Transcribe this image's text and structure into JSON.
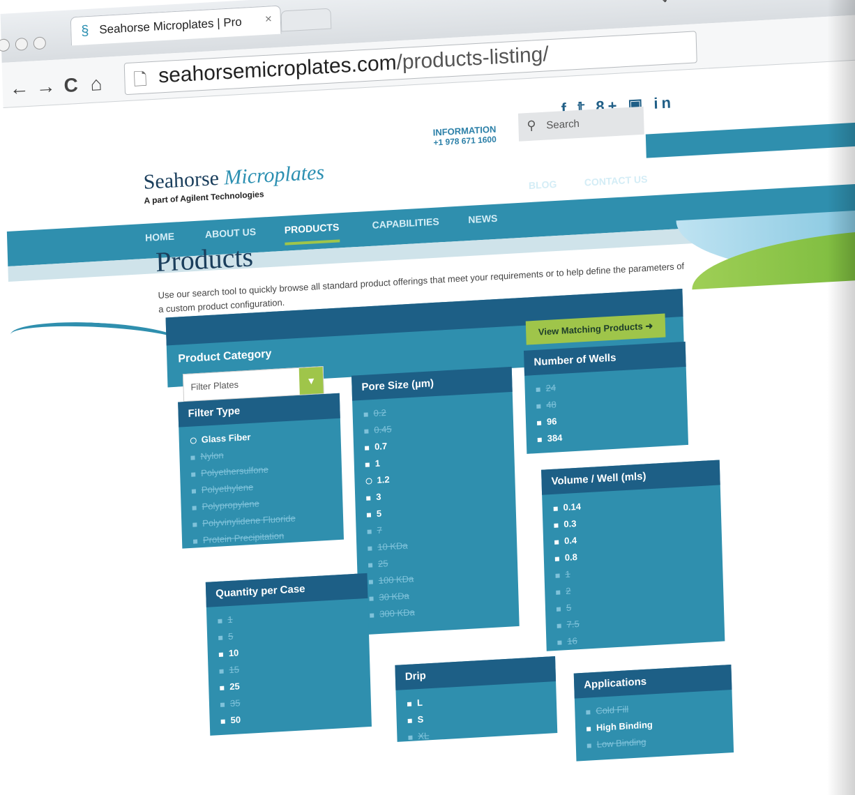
{
  "browser": {
    "tab_title": "Seahorse Microplates | Pro",
    "tab_close": "×",
    "url_host": "seahorsemicroplates.com",
    "url_path": "/products-listing/",
    "nav": {
      "back": "←",
      "forward": "→",
      "reload": "C",
      "home": "⌂"
    },
    "tools": "🔍 ☆"
  },
  "header": {
    "social": "f 𝕥 8+ ▣ in",
    "info_label": "INFORMATION",
    "info_phone": "+1 978 671 1600",
    "search_placeholder": "Search",
    "logo_name_a": "Seahorse",
    "logo_name_b": "Microplates",
    "logo_tag": "A part of Agilent Technologies"
  },
  "nav": {
    "items": [
      "HOME",
      "ABOUT US",
      "PRODUCTS",
      "CAPABILITIES",
      "NEWS",
      "BLOG",
      "CONTACT US"
    ]
  },
  "main": {
    "title": "Products",
    "description": "Use our search tool to quickly browse all standard product offerings that meet your requirements or to help define the parameters of a custom product configuration.",
    "category_title": "Product Category",
    "category_value": "Filter Plates",
    "view_button": "View Matching Products"
  },
  "filters": {
    "filter_type": {
      "title": "Filter Type",
      "items": [
        {
          "label": "Glass Fiber",
          "state": "selected"
        },
        {
          "label": "Nylon",
          "state": "off"
        },
        {
          "label": "Polyethersulfone",
          "state": "off"
        },
        {
          "label": "Polyethylene",
          "state": "off"
        },
        {
          "label": "Polypropylene",
          "state": "off"
        },
        {
          "label": "Polyvinylidene Fluoride",
          "state": "off"
        },
        {
          "label": "Protein Precipitation",
          "state": "off"
        }
      ]
    },
    "pore_size": {
      "title": "Pore Size (µm)",
      "items": [
        {
          "label": "0.2",
          "state": "off"
        },
        {
          "label": "0.45",
          "state": "off"
        },
        {
          "label": "0.7",
          "state": "on"
        },
        {
          "label": "1",
          "state": "on"
        },
        {
          "label": "1.2",
          "state": "selected"
        },
        {
          "label": "3",
          "state": "on"
        },
        {
          "label": "5",
          "state": "on"
        },
        {
          "label": "7",
          "state": "off"
        },
        {
          "label": "10 KDa",
          "state": "off"
        },
        {
          "label": "25",
          "state": "off"
        },
        {
          "label": "100 KDa",
          "state": "off"
        },
        {
          "label": "30 KDa",
          "state": "off"
        },
        {
          "label": "300 KDa",
          "state": "off"
        }
      ]
    },
    "number_of_wells": {
      "title": "Number of Wells",
      "items": [
        {
          "label": "24",
          "state": "off"
        },
        {
          "label": "48",
          "state": "off"
        },
        {
          "label": "96",
          "state": "on"
        },
        {
          "label": "384",
          "state": "on"
        }
      ]
    },
    "volume_well": {
      "title": "Volume / Well (mls)",
      "items": [
        {
          "label": "0.14",
          "state": "on"
        },
        {
          "label": "0.3",
          "state": "on"
        },
        {
          "label": "0.4",
          "state": "on"
        },
        {
          "label": "0.8",
          "state": "on"
        },
        {
          "label": "1",
          "state": "off"
        },
        {
          "label": "2",
          "state": "off"
        },
        {
          "label": "5",
          "state": "off"
        },
        {
          "label": "7.5",
          "state": "off"
        },
        {
          "label": "16",
          "state": "off"
        }
      ]
    },
    "quantity_per_case": {
      "title": "Quantity per Case",
      "items": [
        {
          "label": "1",
          "state": "off"
        },
        {
          "label": "5",
          "state": "off"
        },
        {
          "label": "10",
          "state": "on"
        },
        {
          "label": "15",
          "state": "off"
        },
        {
          "label": "25",
          "state": "on"
        },
        {
          "label": "35",
          "state": "off"
        },
        {
          "label": "50",
          "state": "on"
        }
      ]
    },
    "drip": {
      "title": "Drip",
      "items": [
        {
          "label": "L",
          "state": "on"
        },
        {
          "label": "S",
          "state": "on"
        },
        {
          "label": "XL",
          "state": "off"
        }
      ]
    },
    "applications": {
      "title": "Applications",
      "items": [
        {
          "label": "Cold Fill",
          "state": "off"
        },
        {
          "label": "High Binding",
          "state": "on"
        },
        {
          "label": "Low Binding",
          "state": "off"
        }
      ]
    }
  }
}
